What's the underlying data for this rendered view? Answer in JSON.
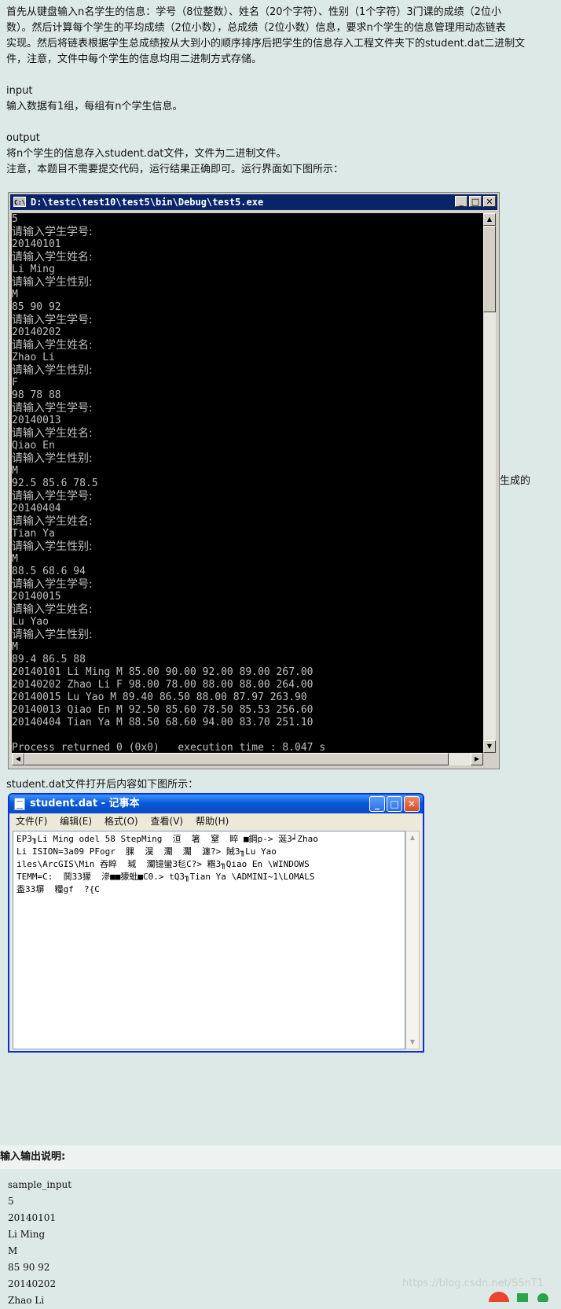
{
  "intro": {
    "lines": [
      "首先从键盘输入n名学生的信息：学号（8位整数）、姓名（20个字符）、性别（1个字符）3门课的成绩（2位小",
      "数）。然后计算每个学生的平均成绩（2位小数），总成绩（2位小数）信息，要求n个学生的信息管理用动态链表",
      "实现。然后将链表根据学生总成绩按从大到小的顺序排序后把学生的信息存入工程文件夹下的student.dat二进制文",
      "件，注意，文件中每个学生的信息均用二进制方式存储。"
    ],
    "input_heading": "input",
    "input_text": "输入数据有1组，每组有n个学生信息。",
    "output_heading": "output",
    "output_lines": [
      "将n个学生的信息存入student.dat文件，文件为二进制文件。",
      "注意，本题目不需要提交代码，运行结果正确即可。运行界面如下图所示："
    ]
  },
  "side_note": "生成的",
  "console": {
    "title": "D:\\testc\\test10\\test5\\bin\\Debug\\test5.exe",
    "icon_label": "C:\\",
    "lines": [
      "5",
      "请输入学生学号:",
      "20140101",
      "请输入学生姓名:",
      "Li Ming",
      "请输入学生性别:",
      "M",
      "85 90 92",
      "请输入学生学号:",
      "20140202",
      "请输入学生姓名:",
      "Zhao Li",
      "请输入学生性别:",
      "F",
      "98 78 88",
      "请输入学生学号:",
      "20140013",
      "请输入学生姓名:",
      "Qiao En",
      "请输入学生性别:",
      "M",
      "92.5 85.6 78.5",
      "请输入学生学号:",
      "20140404",
      "请输入学生姓名:",
      "Tian Ya",
      "请输入学生性别:",
      "M",
      "88.5 68.6 94",
      "请输入学生学号:",
      "20140015",
      "请输入学生姓名:",
      "Lu Yao",
      "请输入学生性别:",
      "M",
      "89.4 86.5 88",
      "20140101 Li Ming M 85.00 90.00 92.00 89.00 267.00",
      "20140202 Zhao Li F 98.00 78.00 88.00 88.00 264.00",
      "20140015 Lu Yao M 89.40 86.50 88.00 87.97 263.90",
      "20140013 Qiao En M 92.50 85.60 78.50 85.53 256.60",
      "20140404 Tian Ya M 88.50 68.60 94.00 83.70 251.10",
      "",
      "Process returned 0 (0x0)   execution time : 8.047 s"
    ]
  },
  "after_console_text": "student.dat文件打开后内容如下图所示：",
  "notepad": {
    "title": "student.dat - 记事本",
    "menu": [
      "文件(F)",
      "编辑(E)",
      "格式(O)",
      "查看(V)",
      "帮助(H)"
    ],
    "content_lines": [
      "EP3╖Li Ming odel 58 StepMing  洹  箸  窒  睟 ■鋼p-> 涎3╛Zhao",
      "Li ISION=3a09 PFogr  腂  淏  灛  灛  瀍?> 賊3╖Lu Yao",
      "iles\\ArcGIS\\Min 吞睟  瑊  灛镱蠻3毝C?> 糌3╖Qiao En \\WINDOWS",
      "TEMM=C:  鬨33獴  滲■■獴蚍■C0.> tQ3╖Tian Ya \\ADMINI~1\\LOMALS",
      "盉33塀  糧gf  ?{C"
    ]
  },
  "io_heading": "输入输出说明:",
  "sample": {
    "lines": [
      "sample_input",
      "5",
      "20140101",
      "Li Ming",
      "M",
      "85 90 92",
      "20140202",
      "Zhao Li"
    ]
  },
  "watermark": "https://blog.csdn.net/SSnT1"
}
